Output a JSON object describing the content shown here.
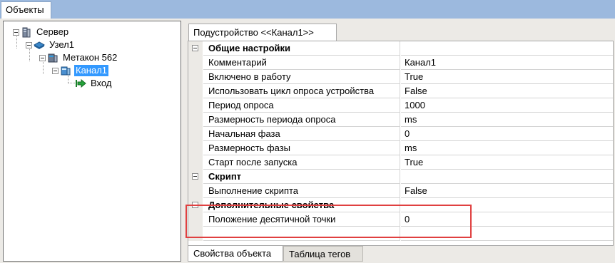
{
  "window": {
    "tab": "Объекты"
  },
  "tree": {
    "nodes": [
      {
        "label": "Сервер",
        "icon": "server-icon"
      },
      {
        "label": "Узел1",
        "icon": "node-icon"
      },
      {
        "label": "Метакон 562",
        "icon": "device-icon"
      },
      {
        "label": "Канал1",
        "icon": "channel-icon",
        "selected": true
      },
      {
        "label": "Вход",
        "icon": "input-arrow-icon"
      }
    ]
  },
  "subtab": {
    "label": "Подустройство <<Канал1>>"
  },
  "properties": {
    "categories": [
      {
        "title": "Общие настройки",
        "rows": [
          {
            "name": "Комментарий",
            "value": "Канал1"
          },
          {
            "name": "Включено в работу",
            "value": "True"
          },
          {
            "name": "Использовать цикл опроса устройства",
            "value": "False"
          },
          {
            "name": "Период опроса",
            "value": "1000"
          },
          {
            "name": "Размерность периода опроса",
            "value": "ms"
          },
          {
            "name": "Начальная фаза",
            "value": "0"
          },
          {
            "name": "Размерность фазы",
            "value": "ms"
          },
          {
            "name": "Старт после запуска",
            "value": "True"
          }
        ]
      },
      {
        "title": "Скрипт",
        "rows": [
          {
            "name": "Выполнение скрипта",
            "value": "False"
          }
        ]
      },
      {
        "title": "Дополнительные свойства",
        "rows": [
          {
            "name": "Положение десятичной точки",
            "value": "0"
          }
        ]
      }
    ]
  },
  "bottom_tabs": [
    "Свойства объекта",
    "Таблица тегов"
  ],
  "colors": {
    "selection": "#3399ff",
    "highlight_frame": "#e04040",
    "header_band": "#9cb9de"
  }
}
